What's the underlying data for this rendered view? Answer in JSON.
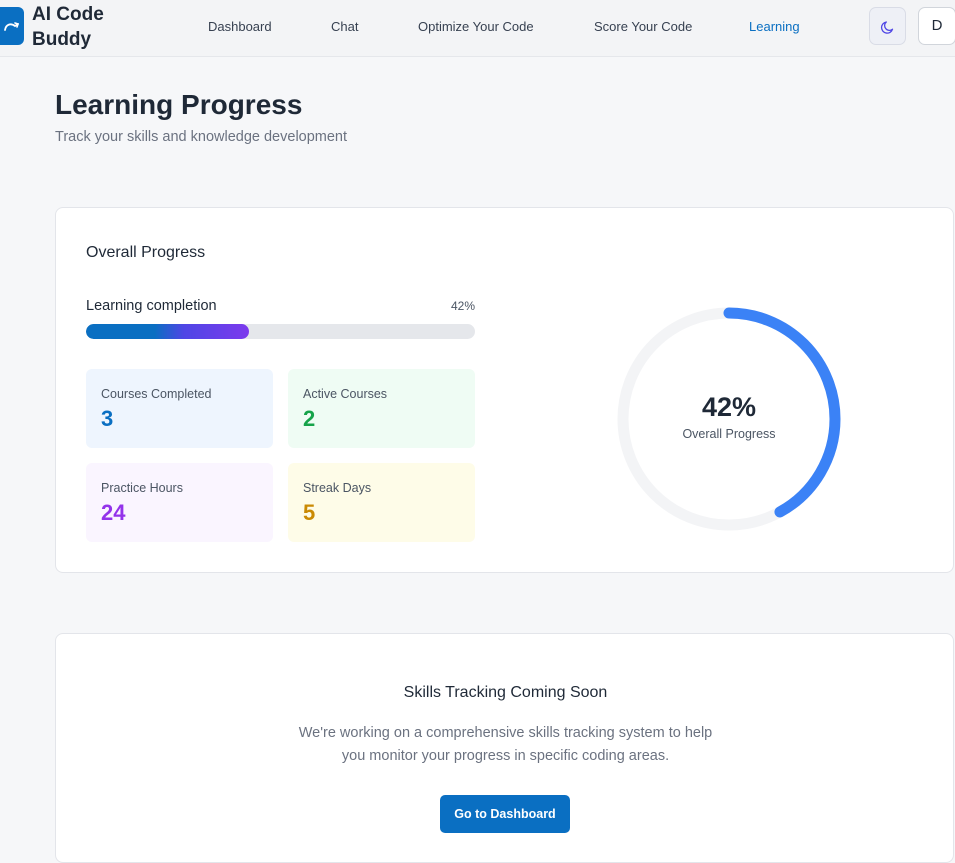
{
  "header": {
    "brand": "AI Code Buddy",
    "nav": [
      {
        "label": "Dashboard",
        "active": false
      },
      {
        "label": "Chat",
        "active": false
      },
      {
        "label": "Optimize Your Code",
        "active": false
      },
      {
        "label": "Score Your Code",
        "active": false
      },
      {
        "label": "Learning",
        "active": true
      }
    ],
    "theme_icon": "moon-icon",
    "avatar_initial": "D"
  },
  "page": {
    "title": "Learning Progress",
    "subtitle": "Track your skills and knowledge development"
  },
  "overall": {
    "title": "Overall Progress",
    "completion_label": "Learning completion",
    "completion_pct_text": "42%",
    "completion_fraction": 0.42,
    "stats": [
      {
        "label": "Courses Completed",
        "value": "3",
        "color": "#0a6fc2",
        "bg": "#eef5fe"
      },
      {
        "label": "Active Courses",
        "value": "2",
        "color": "#16a34a",
        "bg": "#effcf4"
      },
      {
        "label": "Practice Hours",
        "value": "24",
        "color": "#9333ea",
        "bg": "#faf5ff"
      },
      {
        "label": "Streak Days",
        "value": "5",
        "color": "#ca8a04",
        "bg": "#fefce8"
      }
    ],
    "ring": {
      "value_text": "42%",
      "label": "Overall Progress",
      "fraction": 0.42,
      "color": "#3b82f6",
      "track_color": "#f3f4f6"
    }
  },
  "skills": {
    "title": "Skills Tracking Coming Soon",
    "description": "We're working on a comprehensive skills tracking system to help you monitor your progress in specific coding areas.",
    "button_label": "Go to Dashboard"
  }
}
